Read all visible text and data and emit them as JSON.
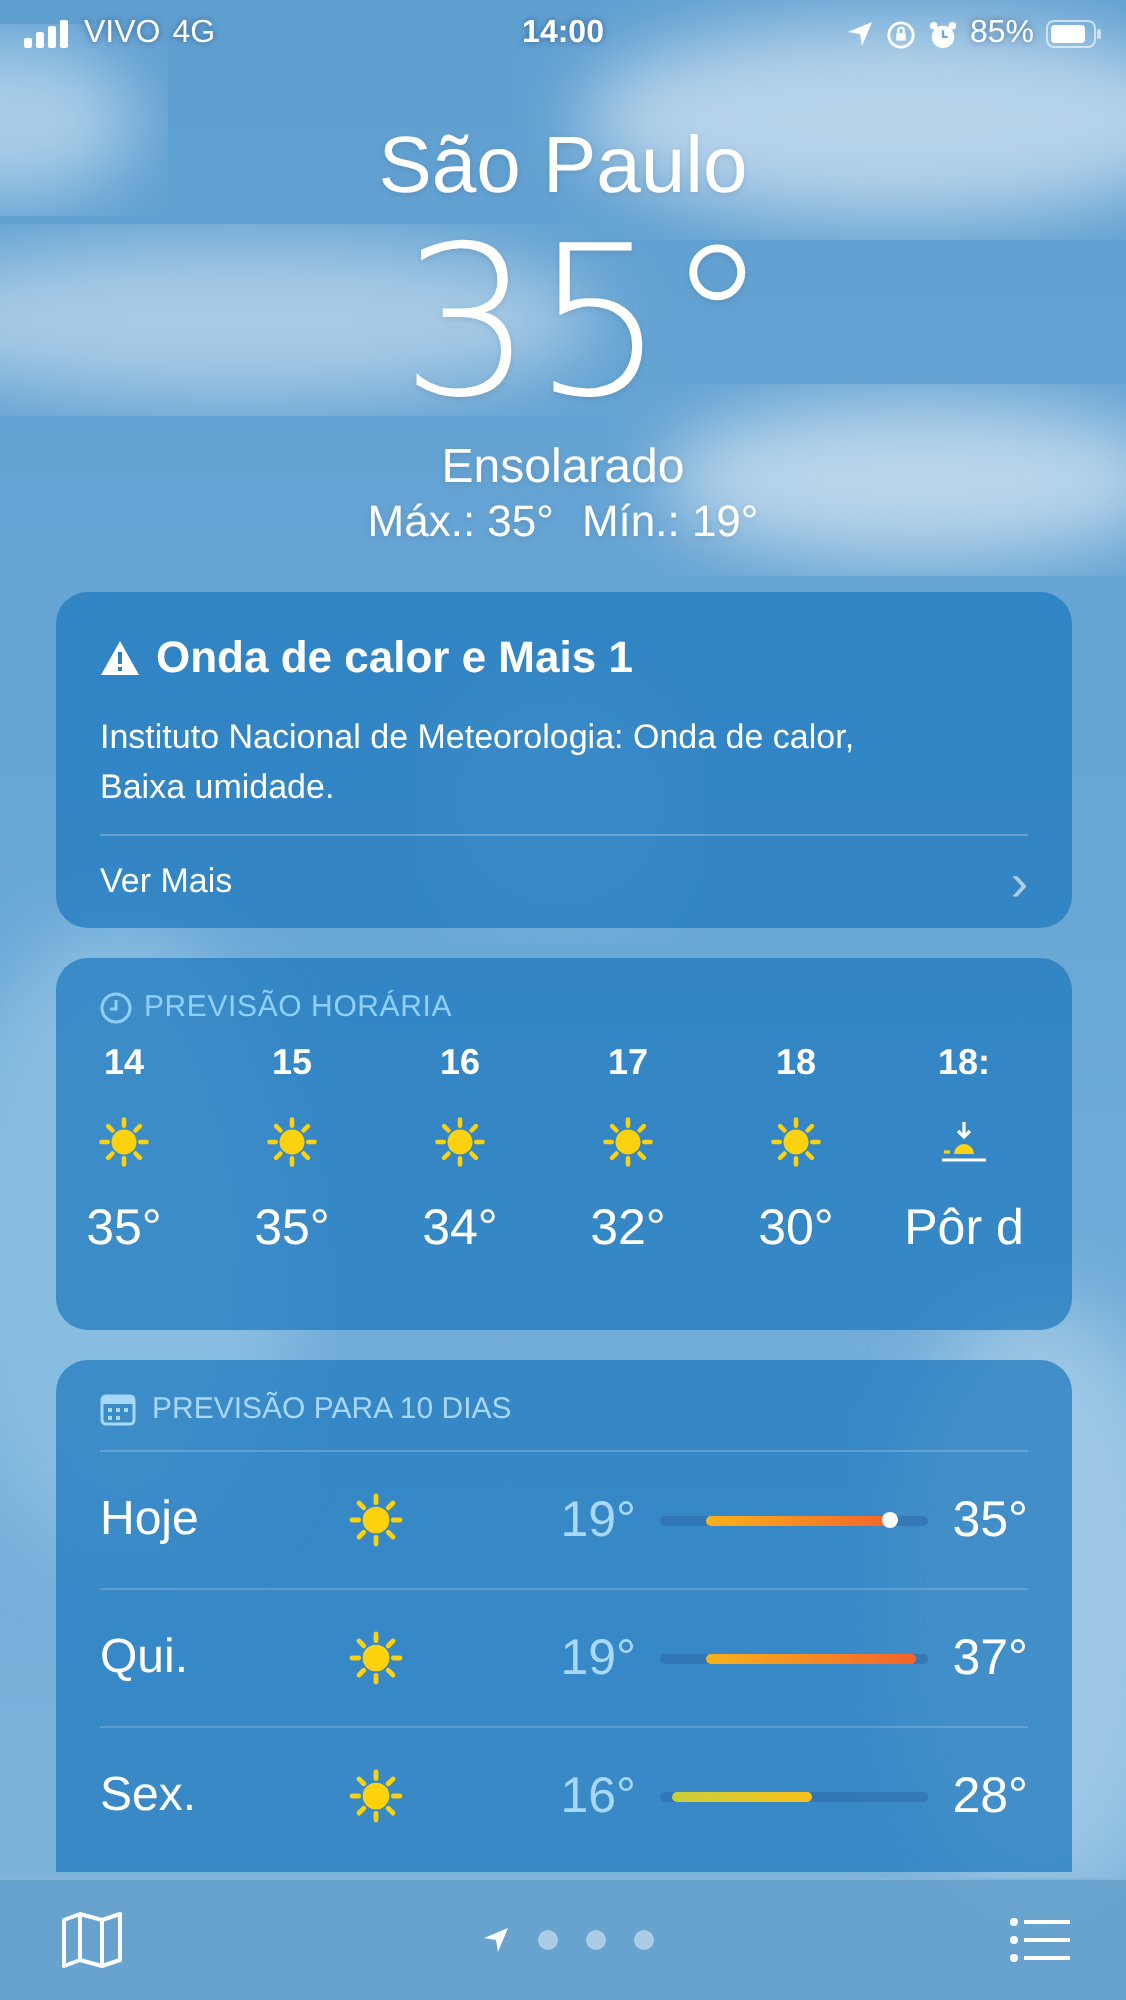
{
  "status_bar": {
    "carrier": "VIVO",
    "network": "4G",
    "time": "14:00",
    "battery": "85%"
  },
  "location": {
    "city": "São Paulo",
    "temperature": "35°",
    "condition": "Ensolarado",
    "high": "Máx.: 35°",
    "low": "Mín.: 19°"
  },
  "alert": {
    "title": "Onda de calor e Mais 1",
    "text": "Instituto Nacional de Meteorologia: Onda de calor, Baixa umidade.",
    "link": "Ver Mais",
    "chevron": "›"
  },
  "hourly": {
    "title": "PREVISÃO HORÁRIA",
    "hours": [
      {
        "time": "14",
        "kind": "sun",
        "value": "35°"
      },
      {
        "time": "15",
        "kind": "sun",
        "value": "35°"
      },
      {
        "time": "16",
        "kind": "sun",
        "value": "34°"
      },
      {
        "time": "17",
        "kind": "sun",
        "value": "32°"
      },
      {
        "time": "18",
        "kind": "sun",
        "value": "30°"
      },
      {
        "time": "18:",
        "kind": "sunset",
        "value": "Pôr d"
      }
    ]
  },
  "daily": {
    "title": "PREVISÃO PARA 10 DIAS",
    "days": [
      {
        "day": "Hoje",
        "low": "19°",
        "high": "35°",
        "current": true
      },
      {
        "day": "Qui.",
        "low": "19°",
        "high": "37°",
        "current": false
      },
      {
        "day": "Sex.",
        "low": "16°",
        "high": "28°",
        "current": false
      }
    ]
  },
  "pages": [
    {
      "kind": "location",
      "selected": true
    },
    {
      "kind": "dot",
      "selected": false
    },
    {
      "kind": "dot",
      "selected": false
    },
    {
      "kind": "dot",
      "selected": false
    }
  ]
}
